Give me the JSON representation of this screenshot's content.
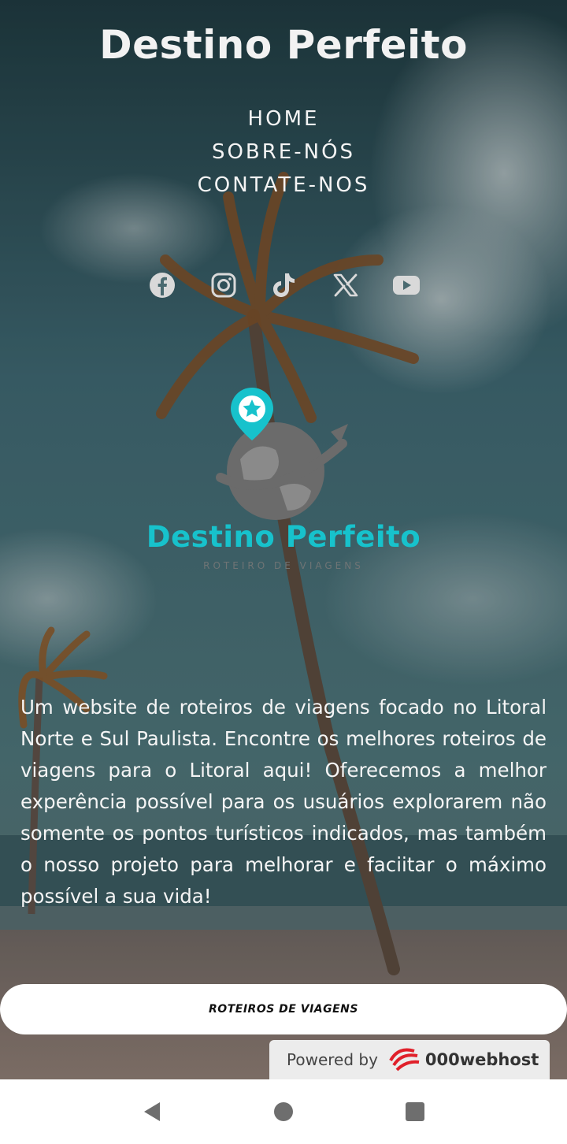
{
  "header": {
    "title": "Destino Perfeito"
  },
  "nav": {
    "items": [
      "HOME",
      "SOBRE-NÓS",
      "CONTATE-NOS"
    ]
  },
  "social": {
    "icons": [
      "facebook-icon",
      "instagram-icon",
      "tiktok-icon",
      "x-icon",
      "youtube-icon"
    ]
  },
  "logo": {
    "name": "Destino Perfeito",
    "tagline": "ROTEIRO DE VIAGENS",
    "accent_color": "#17c2cc",
    "globe_color": "#6b6b6b"
  },
  "description": "Um website de roteiros de viagens focado no Litoral Norte e Sul Paulista. Encontre os melhores roteiros de viagens para o Litoral aqui! Oferecemos a melhor experência possível para os usuários explorarem não somente os pontos turísticos indicados, mas também o nosso projeto para melhorar e faciitar o máximo possível a sua vida!",
  "cta": {
    "label": "ROTEIROS DE VIAGENS"
  },
  "footer_badge": {
    "prefix": "Powered by",
    "brand": "000webhost"
  },
  "system_nav": {
    "icons": [
      "back-icon",
      "home-icon",
      "recents-icon"
    ]
  }
}
